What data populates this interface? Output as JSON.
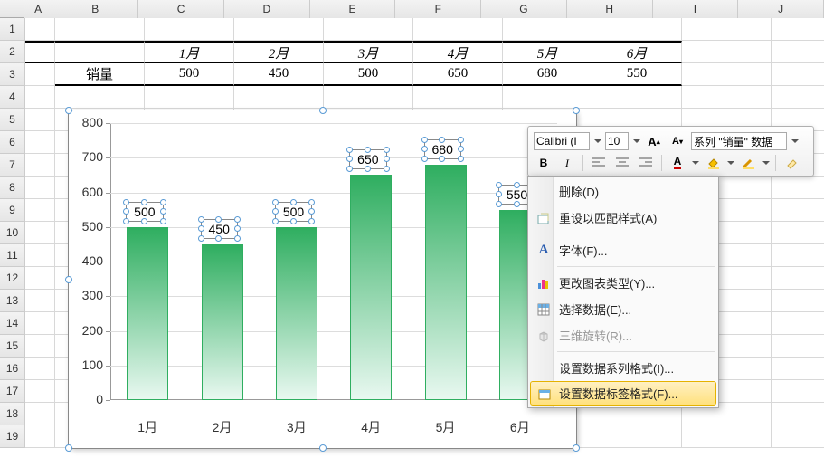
{
  "columns": [
    "A",
    "B",
    "C",
    "D",
    "E",
    "F",
    "G",
    "H",
    "I",
    "J"
  ],
  "row_count": 19,
  "table": {
    "header_label": "",
    "months": [
      "1月",
      "2月",
      "3月",
      "4月",
      "5月",
      "6月"
    ],
    "row_label": "销量",
    "values": [
      "500",
      "450",
      "500",
      "650",
      "680",
      "550"
    ]
  },
  "chart_data": {
    "type": "bar",
    "categories": [
      "1月",
      "2月",
      "3月",
      "4月",
      "5月",
      "6月"
    ],
    "values": [
      500,
      450,
      500,
      650,
      680,
      550
    ],
    "ylabel": "",
    "xlabel": "",
    "title": "",
    "ylim": [
      0,
      800
    ],
    "y_ticks": [
      0,
      100,
      200,
      300,
      400,
      500,
      600,
      700,
      800
    ],
    "series_name": "销量"
  },
  "mini_toolbar": {
    "font_name": "Calibri (I",
    "font_size": "10",
    "grow_font": "A↑",
    "shrink_font": "A↓",
    "series_selector": "系列 \"销量\" 数据",
    "bold": "B",
    "italic": "I"
  },
  "context_menu": {
    "items": [
      {
        "label": "删除(D)",
        "icon": ""
      },
      {
        "label": "重设以匹配样式(A)",
        "icon": "reset"
      },
      {
        "label": "字体(F)...",
        "icon": "font"
      },
      {
        "label": "更改图表类型(Y)...",
        "icon": "chart-type"
      },
      {
        "label": "选择数据(E)...",
        "icon": "select-data"
      },
      {
        "label": "三维旋转(R)...",
        "icon": "3d",
        "disabled": true
      },
      {
        "label": "设置数据系列格式(I)...",
        "icon": ""
      },
      {
        "label": "设置数据标签格式(F)...",
        "icon": "format",
        "highlight": true
      }
    ]
  }
}
